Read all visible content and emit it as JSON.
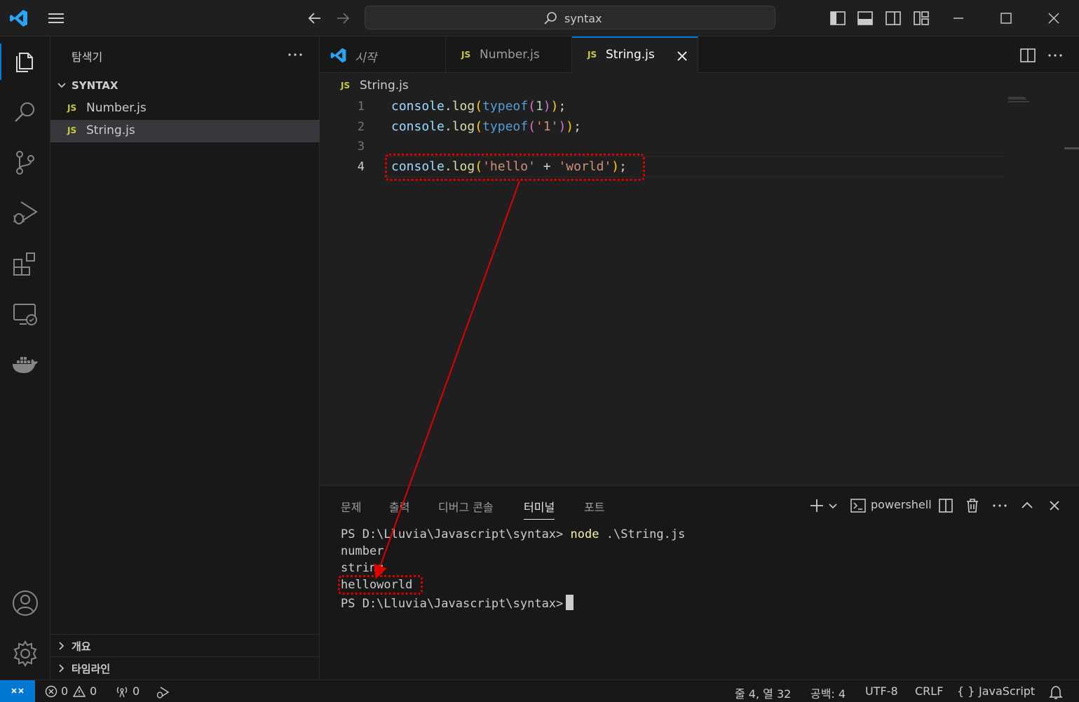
{
  "titlebar": {
    "search_text": "syntax"
  },
  "sidebar": {
    "title": "탐색기",
    "folder_name": "SYNTAX",
    "files": [
      {
        "badge": "JS",
        "name": "Number.js"
      },
      {
        "badge": "JS",
        "name": "String.js"
      }
    ],
    "sections": [
      {
        "name": "개요"
      },
      {
        "name": "타임라인"
      }
    ]
  },
  "tabs": [
    {
      "name": "시작"
    },
    {
      "badge": "JS",
      "name": "Number.js"
    },
    {
      "badge": "JS",
      "name": "String.js"
    }
  ],
  "editor": {
    "breadcrumb_badge": "JS",
    "breadcrumb_file": "String.js",
    "line_numbers": [
      "1",
      "2",
      "3",
      "4"
    ],
    "lines": [
      "console.log(typeof(1));",
      "console.log(typeof('1'));",
      "",
      "console.log('hello' + 'world');"
    ]
  },
  "panel": {
    "tabs": [
      "문제",
      "출력",
      "디버그 콘솔",
      "터미널",
      "포트"
    ],
    "active_tab": "터미널",
    "shell_name": "powershell"
  },
  "terminal": {
    "prompt": "PS D:\\Lluvia\\Javascript\\syntax>",
    "command_node": "node",
    "command_arg": " .\\String.js",
    "output": [
      "number",
      "string",
      "helloworld"
    ]
  },
  "statusbar": {
    "errors": "0",
    "warnings": "0",
    "ports": "0",
    "position": "줄 4, 열 32",
    "spaces": "공백: 4",
    "encoding": "UTF-8",
    "eol": "CRLF",
    "language_bracket": "{ }",
    "language": "JavaScript"
  },
  "colors": {
    "accent": "#0078d4",
    "annotation": "#e00000",
    "js_badge": "#cbcb41"
  }
}
